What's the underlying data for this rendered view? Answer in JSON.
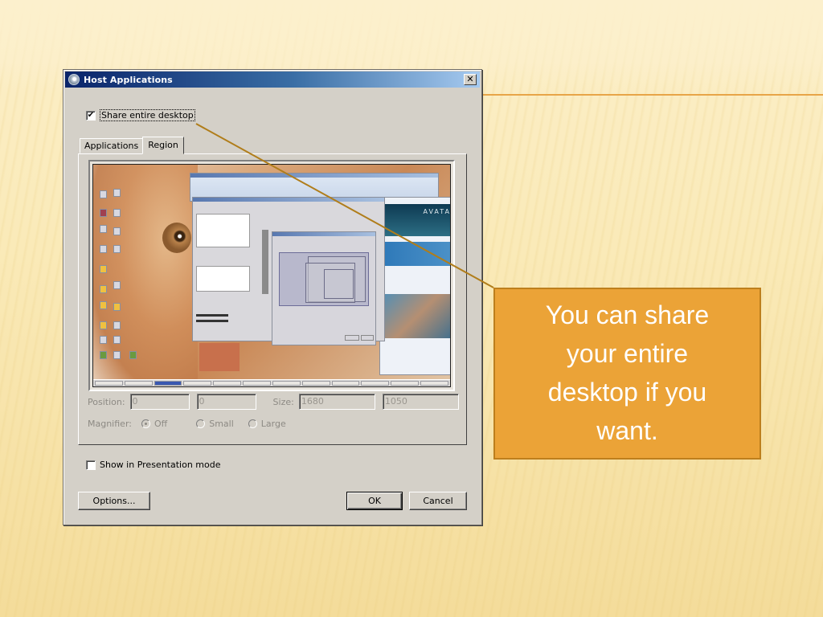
{
  "slide": {
    "accent_color": "#eba337",
    "rule_color": "#e7a548",
    "connector_color": "#b07d1a"
  },
  "dialog": {
    "title": "Host Applications",
    "close_label": "✕",
    "share_desktop": {
      "label": "Share entire desktop",
      "checked": true,
      "check_glyph": "✔"
    },
    "tabs": [
      {
        "label": "Applications",
        "active": false
      },
      {
        "label": "Region",
        "active": true
      }
    ],
    "preview": {
      "description": "Desktop preview thumbnail",
      "browser_banner_text": "AVATA"
    },
    "position": {
      "label": "Position:",
      "x": "0",
      "y": "0"
    },
    "size": {
      "label": "Size:",
      "width": "1680",
      "height": "1050"
    },
    "magnifier": {
      "label": "Magnifier:",
      "options": [
        {
          "label": "Off",
          "selected": true
        },
        {
          "label": "Small",
          "selected": false
        },
        {
          "label": "Large",
          "selected": false
        }
      ]
    },
    "presentation_mode": {
      "label": "Show in Presentation mode",
      "checked": false
    },
    "buttons": {
      "options": "Options...",
      "ok": "OK",
      "cancel": "Cancel"
    }
  },
  "callout": {
    "text": "You can share your entire desktop if you want."
  }
}
